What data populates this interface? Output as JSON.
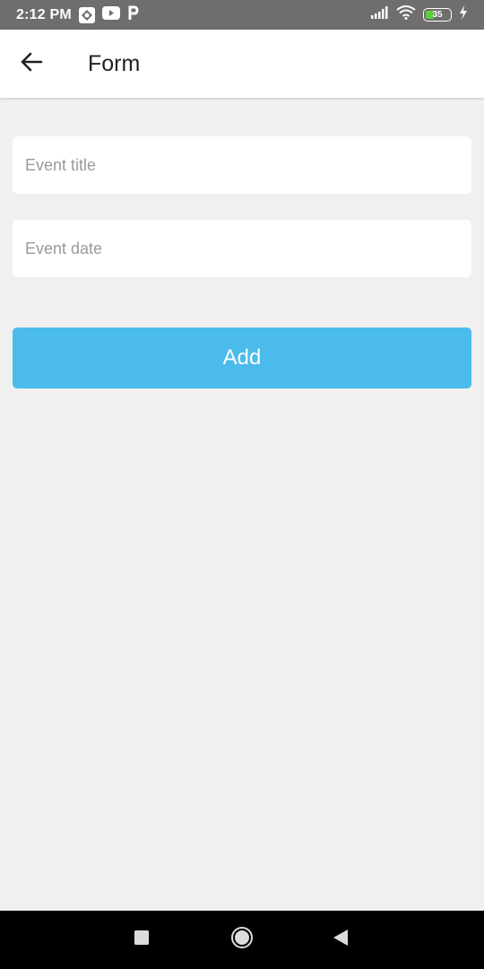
{
  "status_bar": {
    "time": "2:12 PM",
    "icons": [
      "app-icon",
      "youtube-icon",
      "p-icon"
    ],
    "battery_level": "35",
    "battery_color": "#5fcf3a"
  },
  "app_bar": {
    "back_icon": "arrow-left-icon",
    "title": "Form"
  },
  "form": {
    "event_title": {
      "value": "",
      "placeholder": "Event title"
    },
    "event_date": {
      "value": "",
      "placeholder": "Event date"
    },
    "add_label": "Add",
    "add_color": "#4bbbeb"
  },
  "nav_bar": {
    "icons": [
      "recents-square-icon",
      "home-circle-icon",
      "back-triangle-icon"
    ]
  }
}
